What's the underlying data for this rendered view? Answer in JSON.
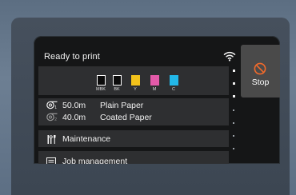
{
  "status": {
    "title": "Ready to print"
  },
  "inks": [
    {
      "label": "MBK",
      "color": "#0b0b0b"
    },
    {
      "label": "BK",
      "color": "#0b0b0b"
    },
    {
      "label": "Y",
      "color": "#f2c21b"
    },
    {
      "label": "M",
      "color": "#e35aa9"
    },
    {
      "label": "C",
      "color": "#22b7e8"
    }
  ],
  "rolls": [
    {
      "icon": "roll-1-icon",
      "length": "50.0m",
      "paper": "Plain Paper"
    },
    {
      "icon": "roll-2-icon",
      "length": "40.0m",
      "paper": "Coated Paper"
    }
  ],
  "menu": {
    "maintenance": "Maintenance",
    "job_management": "Job management"
  },
  "stop_button": {
    "label": "Stop",
    "accent": "#f26a2a"
  },
  "colors": {
    "background": "#151617",
    "panel": "#2e2f31",
    "stop_bg": "#4a4a4a"
  }
}
